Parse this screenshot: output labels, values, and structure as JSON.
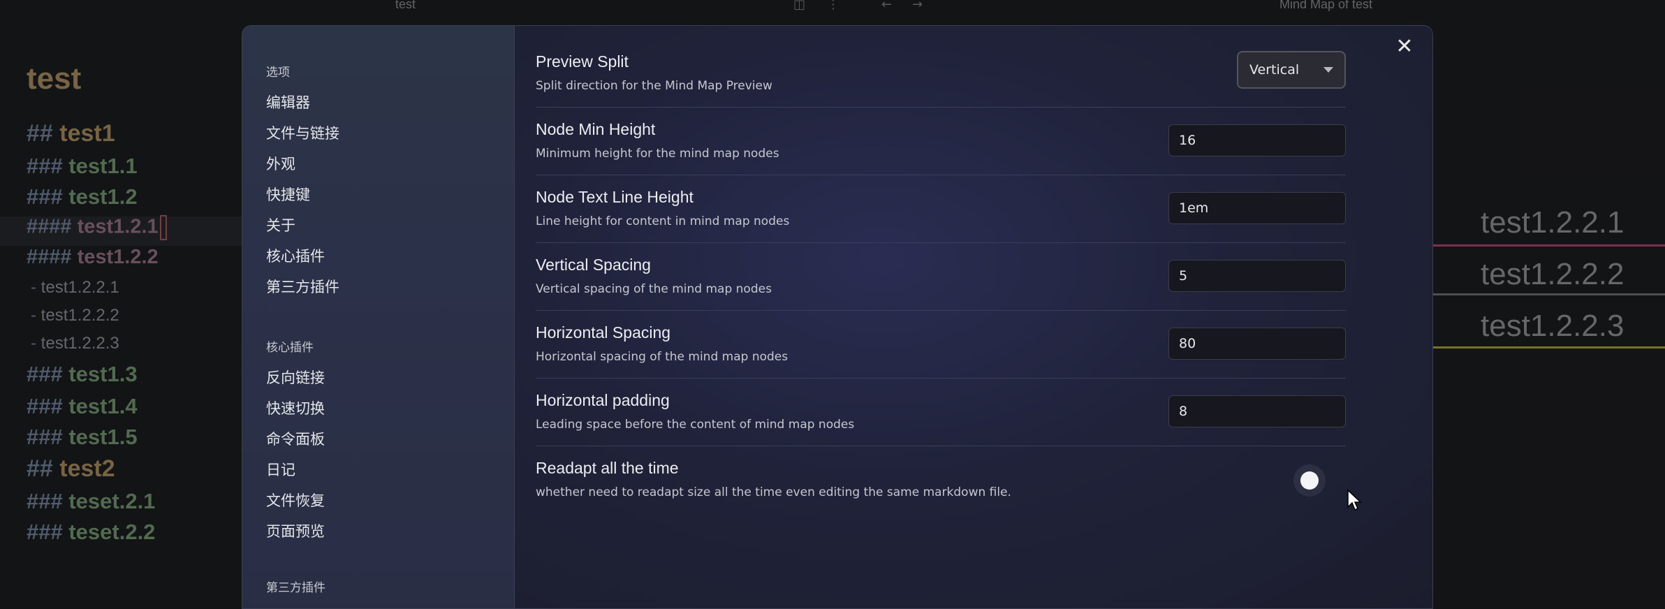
{
  "topbar": {
    "left_title": "test",
    "right_title": "Mind Map of test",
    "split_icon": "split-view-icon",
    "more_icon": "more-options-icon",
    "back_icon": "arrow-back-icon",
    "forward_icon": "arrow-forward-icon"
  },
  "editor": {
    "h1": "test",
    "lines": [
      {
        "hash": "##",
        "text": "test1",
        "level": "h2"
      },
      {
        "hash": "###",
        "text": "test1.1",
        "level": "h3"
      },
      {
        "hash": "###",
        "text": "test1.2",
        "level": "h3"
      },
      {
        "hash": "####",
        "text": "test1.2.1",
        "level": "h4"
      },
      {
        "hash": "####",
        "text": "test1.2.2",
        "level": "h4"
      },
      {
        "hash": "-",
        "text": "test1.2.2.1",
        "level": "li"
      },
      {
        "hash": "-",
        "text": "test1.2.2.2",
        "level": "li"
      },
      {
        "hash": "-",
        "text": "test1.2.2.3",
        "level": "li"
      },
      {
        "hash": "###",
        "text": "test1.3",
        "level": "h3"
      },
      {
        "hash": "###",
        "text": "test1.4",
        "level": "h3"
      },
      {
        "hash": "###",
        "text": "test1.5",
        "level": "h3"
      },
      {
        "hash": "##",
        "text": "test2",
        "level": "h2"
      },
      {
        "hash": "###",
        "text": "teset.2.1",
        "level": "h3"
      },
      {
        "hash": "###",
        "text": "teset.2.2",
        "level": "h3"
      }
    ]
  },
  "mindmap": {
    "nodes": [
      "test1.2.2.1",
      "test1.2.2.2",
      "test1.2.2.3"
    ],
    "colors": [
      "#c2487a",
      "#8a8a8a",
      "#b8b23a"
    ]
  },
  "sidebar": {
    "section1": "选项",
    "items1": [
      "编辑器",
      "文件与链接",
      "外观",
      "快捷键",
      "关于",
      "核心插件",
      "第三方插件"
    ],
    "section2": "核心插件",
    "items2": [
      "反向链接",
      "快速切换",
      "命令面板",
      "日记",
      "文件恢复",
      "页面预览"
    ],
    "section3": "第三方插件"
  },
  "settings": {
    "close_icon": "close-icon",
    "preview_split": {
      "name": "Preview Split",
      "desc": "Split direction for the Mind Map Preview",
      "value": "Vertical"
    },
    "node_min_height": {
      "name": "Node Min Height",
      "desc": "Minimum height for the mind map nodes",
      "value": "16"
    },
    "node_text_line_height": {
      "name": "Node Text Line Height",
      "desc": "Line height for content in mind map nodes",
      "value": "1em"
    },
    "vertical_spacing": {
      "name": "Vertical Spacing",
      "desc": "Vertical spacing of the mind map nodes",
      "value": "5"
    },
    "horizontal_spacing": {
      "name": "Horizontal Spacing",
      "desc": "Horizontal spacing of the mind map nodes",
      "value": "80"
    },
    "horizontal_padding": {
      "name": "Horizontal padding",
      "desc": "Leading space before the content of mind map nodes",
      "value": "8"
    },
    "readapt": {
      "name": "Readapt all the time",
      "desc": "whether need to readapt size all the time even editing the same markdown file.",
      "enabled": false
    }
  }
}
